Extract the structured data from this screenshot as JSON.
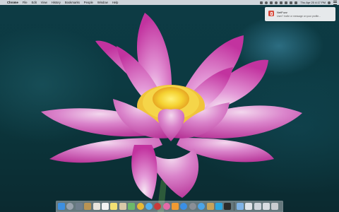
{
  "menubar": {
    "apple_symbol": "",
    "items": [
      "Chrome",
      "File",
      "Edit",
      "View",
      "History",
      "Bookmarks",
      "People",
      "Window",
      "Help"
    ],
    "clock": "Thu Apr 20  4:17 PM",
    "status_icons": [
      "chrome-extension-icon",
      "user-icon",
      "vpn-icon",
      "sync-icon",
      "wifi-icon",
      "bluetooth-icon",
      "volume-icon",
      "battery-icon",
      "spotlight-icon"
    ]
  },
  "notification": {
    "title": "NetFuzz",
    "body": "User? Invite or message on your profile...",
    "accent": "#d64a3c"
  },
  "dock": {
    "apps": [
      {
        "name": "finder-icon",
        "color": "#3d8fe0",
        "shape": "square"
      },
      {
        "name": "launchpad-icon",
        "color": "#9aa3ad",
        "shape": "round"
      },
      {
        "name": "mission-control-icon",
        "color": "#6f7e8c",
        "shape": "square"
      },
      {
        "name": "books-icon",
        "color": "#b99453",
        "shape": "square"
      },
      {
        "name": "photos-icon",
        "color": "#e8e4dc",
        "shape": "square"
      },
      {
        "name": "calendar-icon",
        "color": "#f2f2f2",
        "shape": "square"
      },
      {
        "name": "notes-icon",
        "color": "#f3e173",
        "shape": "square"
      },
      {
        "name": "contacts-icon",
        "color": "#d8c9a8",
        "shape": "square"
      },
      {
        "name": "maps-icon",
        "color": "#6cb96a",
        "shape": "square"
      },
      {
        "name": "chrome-icon",
        "color": "#e9b934",
        "shape": "round"
      },
      {
        "name": "messages-icon",
        "color": "#4fb0f0",
        "shape": "round"
      },
      {
        "name": "photobooth-icon",
        "color": "#c93a3a",
        "shape": "round"
      },
      {
        "name": "music-icon",
        "color": "#e46ba8",
        "shape": "round"
      },
      {
        "name": "ibooks-icon",
        "color": "#f09a32",
        "shape": "square"
      },
      {
        "name": "app-store-icon",
        "color": "#3a8fe6",
        "shape": "round"
      },
      {
        "name": "system-preferences-icon",
        "color": "#8a8f96",
        "shape": "round"
      },
      {
        "name": "safari-icon",
        "color": "#4ba4e8",
        "shape": "round"
      },
      {
        "name": "preview-icon",
        "color": "#c7a35a",
        "shape": "square"
      },
      {
        "name": "skype-icon",
        "color": "#2aa6e0",
        "shape": "square"
      },
      {
        "name": "terminal-icon",
        "color": "#2b2b2b",
        "shape": "square"
      }
    ],
    "right_items": [
      {
        "name": "downloads-folder-icon",
        "color": "#7fb3e6",
        "shape": "square"
      },
      {
        "name": "document-stack-icon",
        "color": "#dfe3e8",
        "shape": "square"
      },
      {
        "name": "screenshot-stack-icon",
        "color": "#cfd5dc",
        "shape": "square"
      },
      {
        "name": "folder-stack-icon",
        "color": "#d9dde2",
        "shape": "square"
      },
      {
        "name": "trash-icon",
        "color": "#c9ccd0",
        "shape": "square"
      }
    ]
  }
}
